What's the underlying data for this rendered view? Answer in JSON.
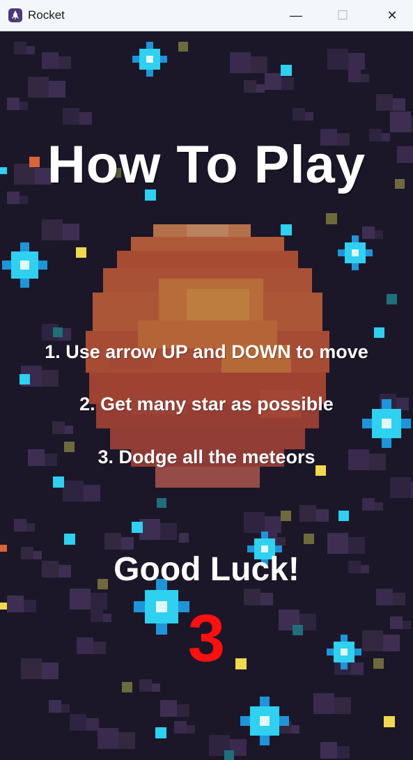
{
  "window": {
    "title": "Rocket",
    "minimize_glyph": "—",
    "maximize_glyph": "☐",
    "close_glyph": "✕"
  },
  "screen": {
    "heading": "How To Play",
    "instructions": [
      "1. Use arrow UP and DOWN to move",
      "2. Get many star as possible",
      "3. Dodge all the meteors"
    ],
    "farewell": "Good Luck!",
    "countdown": "3"
  },
  "colors": {
    "background": "#1b1728",
    "countdown": "#ff1010",
    "text": "#ffffff",
    "planet": "#e0703a",
    "star": "#2fd0f0"
  },
  "icons": {
    "app": "rocket-icon",
    "decor": [
      "planet",
      "sparkle-star",
      "pixel-dot"
    ]
  }
}
